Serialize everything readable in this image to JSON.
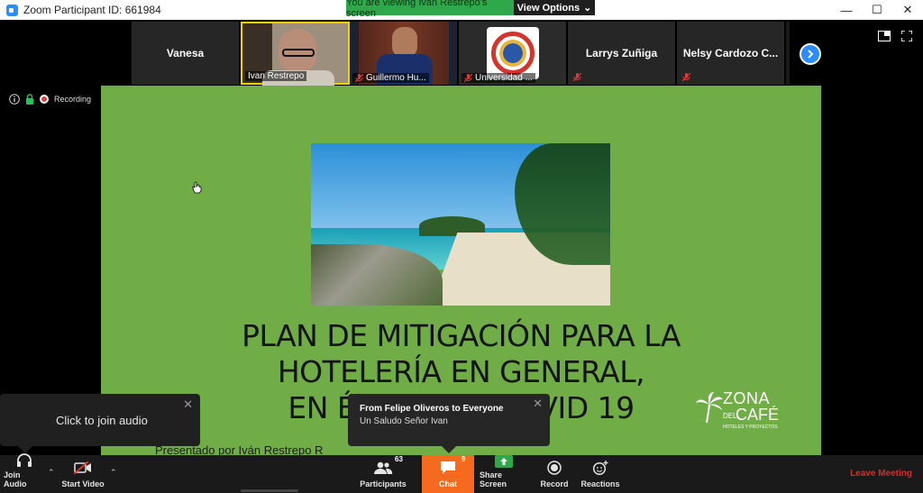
{
  "window": {
    "title": "Zoom Participant ID: 661984",
    "controls": [
      "minimize-icon",
      "maximize-icon",
      "close-icon"
    ]
  },
  "share_banner": {
    "viewing_text": "You are viewing Ivan Restrepo's screen",
    "view_options_label": "View Options"
  },
  "participants_strip": {
    "tiles": [
      {
        "name": "Vanesa",
        "type": "name-only",
        "muted": false
      },
      {
        "name": "Ivan Restrepo",
        "type": "video",
        "muted": false,
        "active_speaker": true
      },
      {
        "name": "Guillermo Hu...",
        "type": "video",
        "muted": true
      },
      {
        "name": "Universidad ...",
        "type": "logo",
        "muted": true
      },
      {
        "name": "Larrys Zuñiga",
        "type": "name-only",
        "muted": true
      },
      {
        "name": "Nelsy Cardozo C...",
        "type": "name-only",
        "muted": true
      }
    ],
    "next_icon": "chevron-right-icon"
  },
  "meeting_status": {
    "recording_label": "Recording"
  },
  "slide": {
    "title_line1": "PLAN DE MITIGACIÓN PARA LA",
    "title_line2": "HOTELERÍA EN GENERAL,",
    "title_line3": "EN ÉPOCA DE COVID 19",
    "presenter": "Presentado por Iván Restrepo R",
    "brand": {
      "zona": "ZONA",
      "del": "DEL",
      "cafe": "CAFÉ",
      "tagline": "HOTELES Y PROYECTOS"
    }
  },
  "join_audio_popup": {
    "text": "Click to join audio"
  },
  "chat_popup": {
    "from": "From Felipe Oliveros to Everyone",
    "message": "Un Saludo Señor Ivan"
  },
  "toolbar": {
    "join_audio": "Join Audio",
    "start_video": "Start Video",
    "participants": "Participants",
    "participants_count": "63",
    "chat": "Chat",
    "chat_count": "9",
    "share_screen": "Share Screen",
    "record": "Record",
    "reactions": "Reactions",
    "leave_meeting": "Leave Meeting"
  },
  "colors": {
    "slide_background": "#70ad47",
    "zoom_blue": "#2d8cff",
    "banner_green": "#2ea84a",
    "chat_orange": "#f56a1f",
    "leave_red": "#e02828"
  }
}
